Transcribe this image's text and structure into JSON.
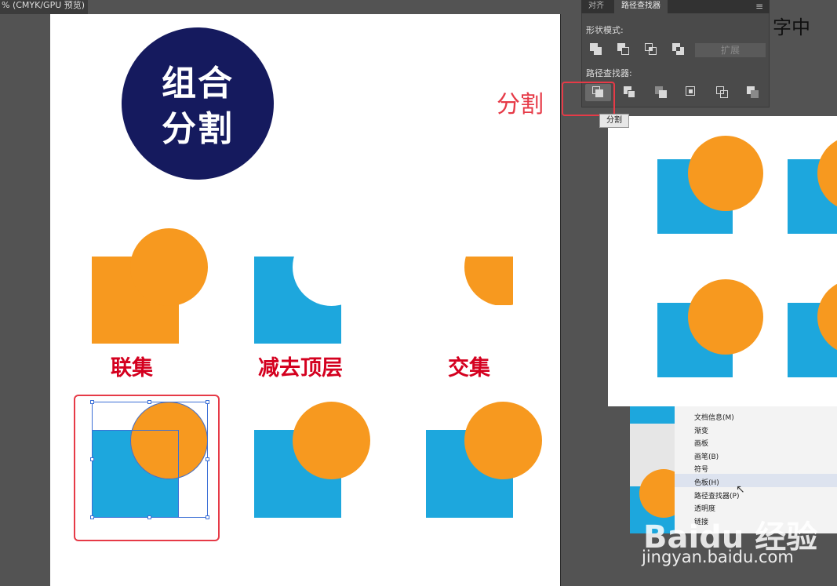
{
  "document": {
    "tab_title": "% (CMYK/GPU 预览)"
  },
  "artboard": {
    "title_lines": [
      "组合",
      "分割"
    ],
    "labels": {
      "unite": "联集",
      "minus_front": "减去顶层",
      "intersect": "交集"
    }
  },
  "pathfinder_panel": {
    "tabs": [
      "对齐",
      "路径查找器"
    ],
    "active_tab": "路径查找器",
    "shape_modes_label": "形状模式:",
    "pathfinders_label": "路径查找器:",
    "expand_label": "扩展",
    "shape_mode_icons": [
      "unite-icon",
      "minus-front-icon",
      "intersect-icon",
      "exclude-icon"
    ],
    "pathfinder_icons": [
      "divide-icon",
      "trim-icon",
      "merge-icon",
      "crop-icon",
      "outline-icon",
      "minus-back-icon"
    ],
    "tooltip": "分割",
    "menu_icon": "hamburger-icon"
  },
  "annotation": {
    "divide_label": "分割"
  },
  "window_menu": {
    "items": [
      "文档信息(M)",
      "渐变",
      "画板",
      "画笔(B)",
      "符号",
      "色板(H)",
      "路径查找器(P)",
      "透明度",
      "链接"
    ],
    "highlighted": "色板(H)"
  },
  "top_right_text": "字中",
  "watermark": {
    "logo": "Baidu 经验",
    "url": "jingyan.baidu.com"
  },
  "colors": {
    "orange": "#f7991f",
    "blue": "#1da7dd",
    "navy": "#151a5e",
    "label_red": "#d4001f",
    "highlight_red": "#e63a47"
  }
}
